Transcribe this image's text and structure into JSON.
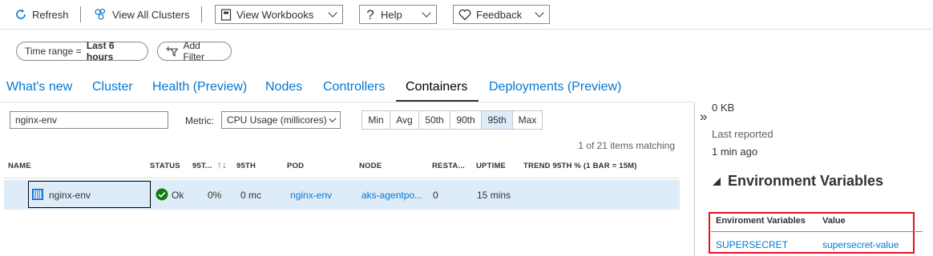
{
  "toolbar": {
    "refresh_label": "Refresh",
    "view_all_clusters_label": "View All Clusters",
    "view_workbooks_label": "View Workbooks",
    "help_label": "Help",
    "feedback_label": "Feedback"
  },
  "filters": {
    "time_range_prefix": "Time range = ",
    "time_range_value": "Last 6 hours",
    "add_filter_label": "Add Filter"
  },
  "tabs": [
    {
      "label": "What's new"
    },
    {
      "label": "Cluster"
    },
    {
      "label": "Health (Preview)"
    },
    {
      "label": "Nodes"
    },
    {
      "label": "Controllers"
    },
    {
      "label": "Containers",
      "active": true
    },
    {
      "label": "Deployments (Preview)"
    }
  ],
  "search": {
    "value": "nginx-env"
  },
  "metric": {
    "label": "Metric:",
    "selected": "CPU Usage (millicores)"
  },
  "percentiles": [
    "Min",
    "Avg",
    "50th",
    "90th",
    "95th",
    "Max"
  ],
  "selected_percentile": "95th",
  "matching_text": "1 of 21 items matching",
  "table": {
    "headers": {
      "name": "NAME",
      "status": "STATUS",
      "p95_pct": "95T...",
      "p95": "95TH",
      "pod": "POD",
      "node": "NODE",
      "restarts": "RESTA...",
      "uptime": "UPTIME",
      "trend": "TREND 95TH % (1 BAR = 15M)"
    },
    "row": {
      "name": "nginx-env",
      "status": "Ok",
      "p95_pct": "0%",
      "p95": "0 mc",
      "pod": "nginx-env",
      "node": "aks-agentpo...",
      "restarts": "0",
      "uptime": "15 mins"
    }
  },
  "panel": {
    "collapse_glyph": "»",
    "size_value": "0 KB",
    "last_reported_label": "Last reported",
    "last_reported_value": "1 min ago",
    "env_section_title": "Environment Variables",
    "env_headers": {
      "name": "Enviroment Variables",
      "value": "Value"
    },
    "env_rows": [
      {
        "name": "SUPERSECRET",
        "value": "supersecret-value"
      }
    ]
  },
  "colors": {
    "accent": "#0078d4",
    "selected_row": "#deecf9",
    "highlight_box": "#e81123",
    "ok_green": "#107c10"
  }
}
